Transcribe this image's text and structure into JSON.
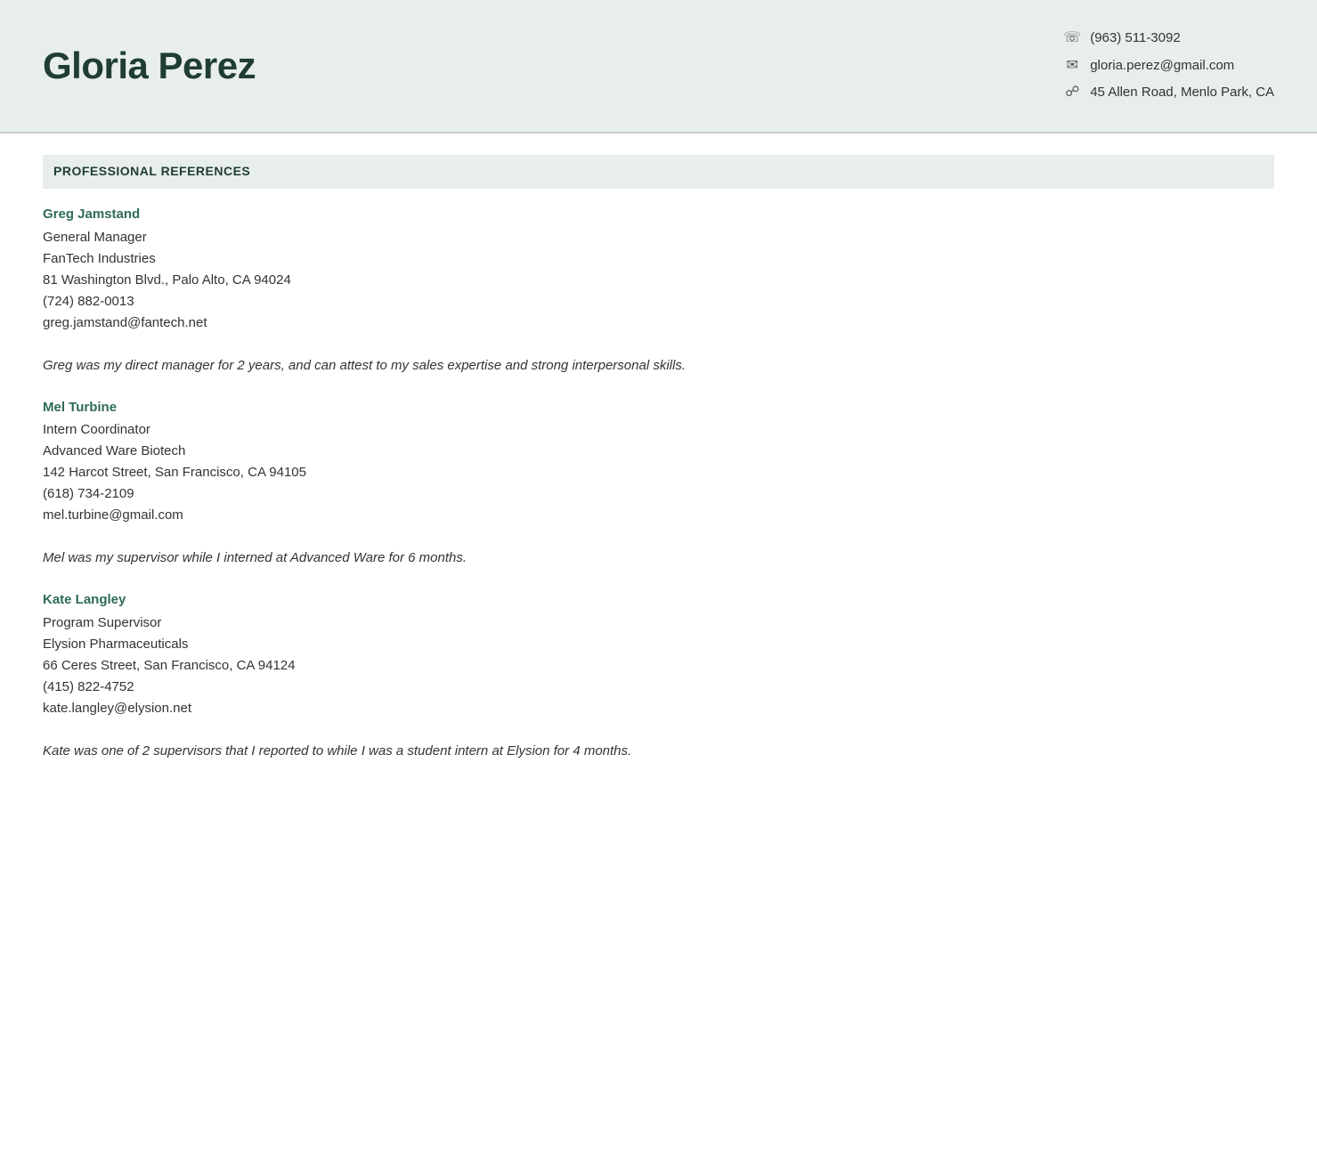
{
  "header": {
    "name": "Gloria Perez",
    "phone": "(963) 511-3092",
    "email": "gloria.perez@gmail.com",
    "address": "45 Allen Road, Menlo Park, CA"
  },
  "section": {
    "title": "PROFESSIONAL REFERENCES"
  },
  "references": [
    {
      "name": "Greg Jamstand",
      "title": "General Manager",
      "company": "FanTech Industries",
      "address": "81 Washington Blvd., Palo Alto, CA 94024",
      "phone": "(724) 882-0013",
      "email": "greg.jamstand@fantech.net",
      "note": "Greg was my direct manager for 2 years, and can attest to my sales expertise and strong interpersonal skills."
    },
    {
      "name": "Mel Turbine",
      "title": "Intern Coordinator",
      "company": "Advanced Ware Biotech",
      "address": "142 Harcot Street, San Francisco, CA 94105",
      "phone": "(618) 734-2109",
      "email": "mel.turbine@gmail.com",
      "note": "Mel was my supervisor while I interned at Advanced Ware for 6 months."
    },
    {
      "name": "Kate Langley",
      "title": "Program Supervisor",
      "company": "Elysion Pharmaceuticals",
      "address": "66 Ceres Street, San Francisco, CA 94124",
      "phone": "(415) 822-4752",
      "email": "kate.langley@elysion.net",
      "note": "Kate was one of 2 supervisors that I reported to while I was a student intern at Elysion for 4 months."
    }
  ]
}
